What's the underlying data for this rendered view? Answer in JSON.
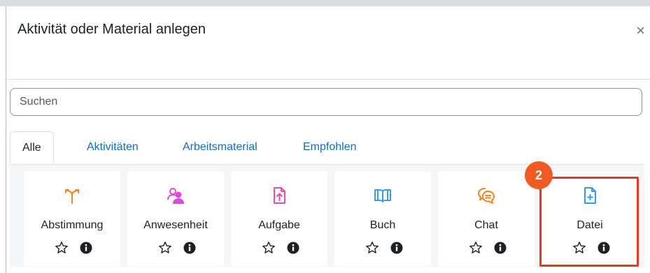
{
  "dialog": {
    "title": "Aktivität oder Material anlegen",
    "close_symbol": "×",
    "search_placeholder": "Suchen",
    "tabs": [
      {
        "label": "Alle",
        "active": true
      },
      {
        "label": "Aktivitäten",
        "active": false
      },
      {
        "label": "Arbeitsmaterial",
        "active": false
      },
      {
        "label": "Empfohlen",
        "active": false
      }
    ],
    "modules": [
      {
        "label": "Abstimmung",
        "icon": "choice-icon",
        "color": "#f7811b"
      },
      {
        "label": "Anwesenheit",
        "icon": "attendance-icon",
        "color": "#d94cdb"
      },
      {
        "label": "Aufgabe",
        "icon": "assignment-icon",
        "color": "#e64ca8"
      },
      {
        "label": "Buch",
        "icon": "book-icon",
        "color": "#399be2"
      },
      {
        "label": "Chat",
        "icon": "chat-icon",
        "color": "#f7811b"
      },
      {
        "label": "Datei",
        "icon": "file-icon",
        "color": "#399be2"
      }
    ],
    "annotation_badge": "2"
  },
  "colors": {
    "link": "#0f6cbf",
    "highlight": "#e03c1e",
    "badge": "#f05a23"
  }
}
